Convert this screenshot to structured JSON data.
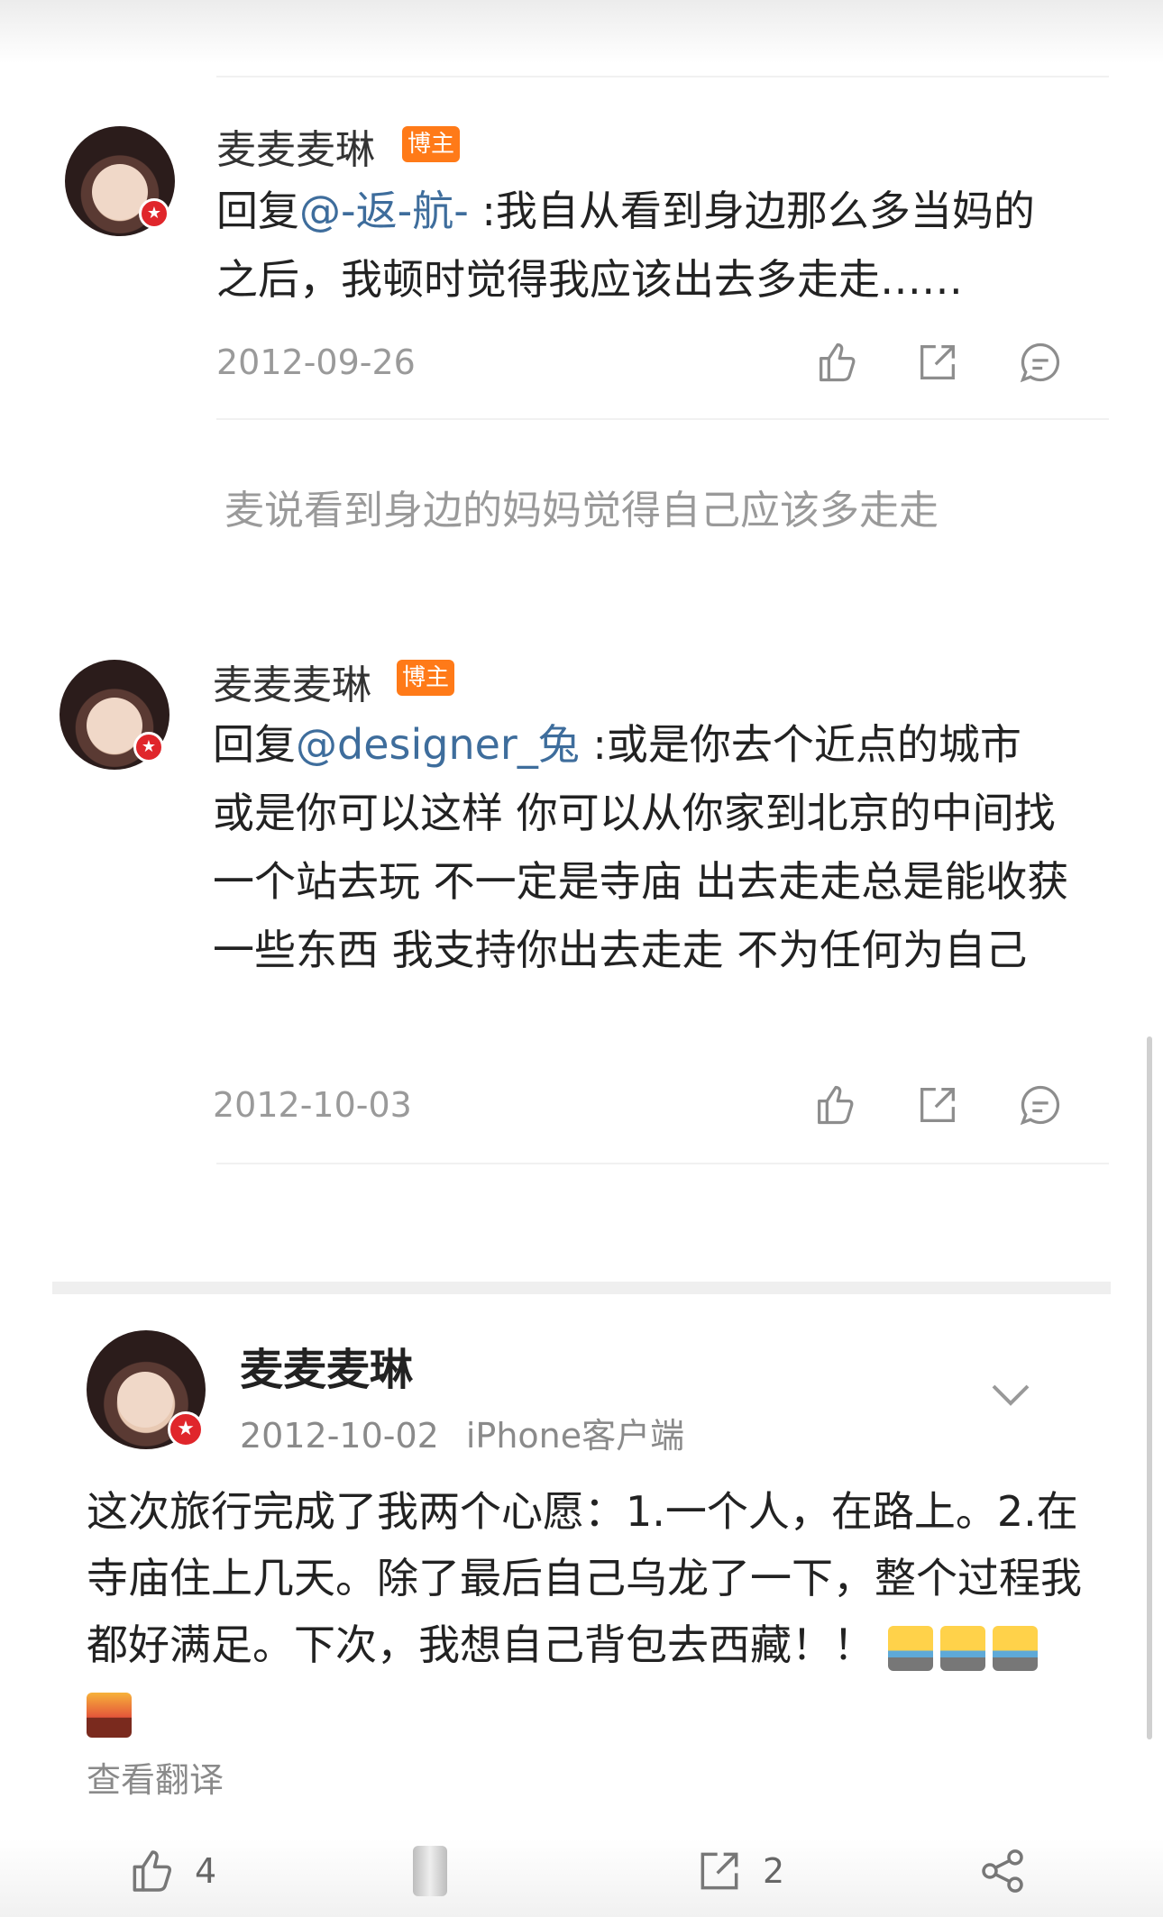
{
  "replies": [
    {
      "name": "麦麦麦琳",
      "tag": "博主",
      "prefix": "回复",
      "mention": "@-返-航-",
      "text_line1": " :我自从看到身边那么多当妈的",
      "text_rest": "之后，我顿时觉得我应该出去多走走……",
      "date": "2012-09-26"
    },
    {
      "name": "麦麦麦琳",
      "tag": "博主",
      "prefix": "回复",
      "mention": "@designer_兔",
      "text_line1": " :或是你去个近点的城市",
      "text_rest": "或是你可以这样 你可以从你家到北京的中间找一个站去玩 不一定是寺庙 出去走走总是能收获一些东西 我支持你出去走走 不为任何为自己",
      "date": "2012-10-03"
    }
  ],
  "note": "麦说看到身边的妈妈觉得自己应该多走走",
  "post": {
    "name": "麦麦麦琳",
    "date": "2012-10-02",
    "source": "iPhone客户端",
    "text": "这次旅行完成了我两个心愿：1.一个人，在路上。2.在寺庙住上几天。除了最后自己乌龙了一下，整个过程我都好满足。下次，我想自己背包去西藏！！",
    "translate": "查看翻译",
    "likes": "4",
    "reposts": "2"
  },
  "icons": {
    "like": "thumbs-up-icon",
    "repost": "share-box-icon",
    "comment": "comment-icon",
    "chevron": "chevron-down-icon",
    "share": "share-nodes-icon"
  },
  "colors": {
    "link": "#3e6d9c",
    "tag": "#ff7a18",
    "badge": "#e0262b"
  }
}
